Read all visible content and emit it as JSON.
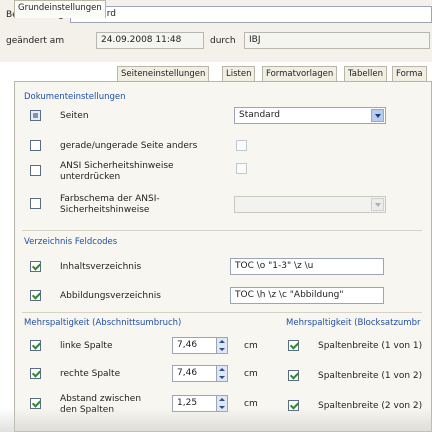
{
  "header": {
    "bezeichnung_label": "Bezeichnung",
    "bezeichnung_value": "Standard",
    "geaendert_label": "geändert am",
    "geaendert_value": "24.09.2008 11:48",
    "durch_label": "durch",
    "durch_value": "IBJ"
  },
  "tabs": [
    "Grundeinstellungen",
    "Seiteneinstellungen",
    "Listen",
    "Formatvorlagen",
    "Tabellen",
    "Forma"
  ],
  "dokument": {
    "title": "Dokumenteinstellungen",
    "rows": [
      {
        "label": "Seiten",
        "select": "Standard"
      },
      {
        "label": "gerade/ungerade Seite anders"
      },
      {
        "label": "ANSI Sicherheitshinweise unterdrücken"
      },
      {
        "label": "Farbschema der ANSI-Sicherheitshinweise"
      }
    ]
  },
  "verzeichnis": {
    "title": "Verzeichnis Feldcodes",
    "rows": [
      {
        "label": "Inhaltsverzeichnis",
        "value": "TOC \\o \"1-3\" \\z \\u"
      },
      {
        "label": "Abbildungsverzeichnis",
        "value": "TOC \\h \\z \\c \"Abbildung\""
      }
    ]
  },
  "mehrspaltig_abschnitt": {
    "title": "Mehrspaltigkeit (Abschnittsumbruch)",
    "rows": [
      {
        "label": "linke Spalte",
        "value": "7,46",
        "unit": "cm"
      },
      {
        "label": "rechte Spalte",
        "value": "7,46",
        "unit": "cm"
      },
      {
        "label": "Abstand zwischen den Spalten",
        "value": "1,25",
        "unit": "cm"
      }
    ]
  },
  "mehrspaltig_block": {
    "title": "Mehrspaltigkeit (Blocksatzumbr",
    "rows": [
      {
        "label": "Spaltenbreite (1 von 1)"
      },
      {
        "label": "Spaltenbreite (1 von 2)"
      },
      {
        "label": "Spaltenbreite (2 von 2)"
      }
    ]
  },
  "colors": {
    "accent": "#1f4fa8",
    "check": "#2d8a2d",
    "panel_bg": "#f7f6f0"
  }
}
